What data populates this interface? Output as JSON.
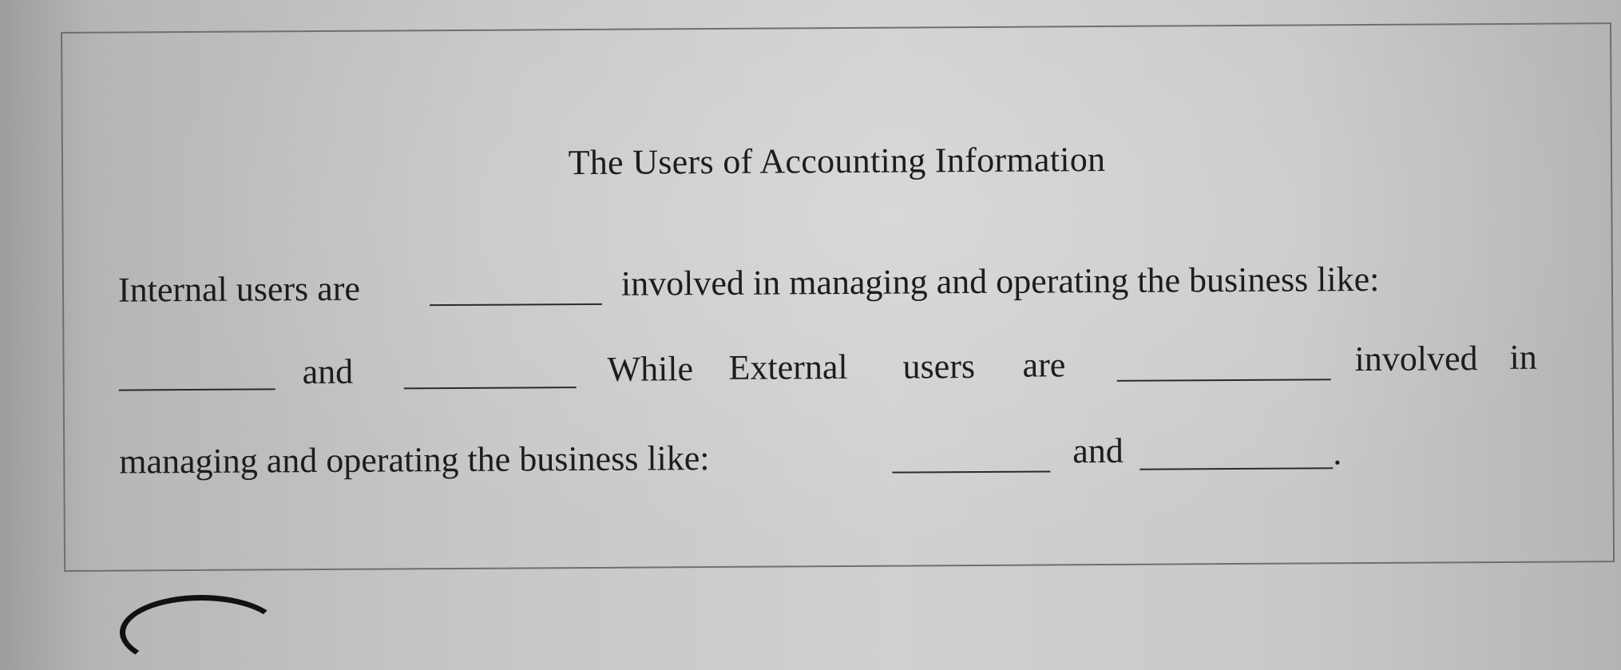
{
  "worksheet": {
    "title": "The Users of Accounting Information",
    "line1": {
      "prefix": "Internal users are",
      "suffix": "involved in managing and operating the business like:"
    },
    "line2": {
      "and": "and",
      "while_external": "While",
      "external": "External",
      "users": "users",
      "are": "are",
      "involved": "involved",
      "in": "in"
    },
    "line3": {
      "prefix": "managing and operating the business like:",
      "and": "and",
      "period": "."
    },
    "blanks": [
      {
        "id": "internal-users-blank",
        "value": ""
      },
      {
        "id": "internal-example-1-blank",
        "value": ""
      },
      {
        "id": "internal-example-2-blank",
        "value": ""
      },
      {
        "id": "external-users-blank",
        "value": ""
      },
      {
        "id": "external-example-1-blank",
        "value": ""
      },
      {
        "id": "external-example-2-blank",
        "value": ""
      }
    ]
  }
}
